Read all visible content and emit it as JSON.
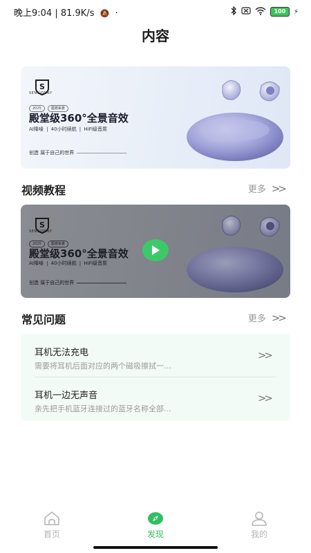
{
  "status_bar": {
    "time_net": "晚上9:04 | 81.9K/s",
    "battery": "100"
  },
  "page_title": "内容",
  "banner": {
    "brand": "SENSIONNY",
    "tags": [
      "2025",
      "震撼来袭"
    ],
    "headline": "殿堂级360°全景音效",
    "features": "AI降噪  |  40小时续航  |  HiFi级音质",
    "slogan": "创造 属于自己的世界"
  },
  "video_section": {
    "title": "视频教程",
    "more": "更多"
  },
  "faq_section": {
    "title": "常见问题",
    "more": "更多",
    "items": [
      {
        "question": "耳机无法充电",
        "answer": "需要将耳机后面对应的两个磁吸擦拭一..."
      },
      {
        "question": "耳机一边无声音",
        "answer": "亲先把手机蓝牙连接过的蓝牙名称全部..."
      }
    ]
  },
  "tabs": [
    {
      "label": "首页",
      "icon": "home-icon"
    },
    {
      "label": "发现",
      "icon": "compass-icon"
    },
    {
      "label": "我的",
      "icon": "profile-icon"
    }
  ],
  "colors": {
    "accent": "#2fbf62",
    "inactive": "#b5b5b5",
    "faq_bg": "#f3fbf7"
  }
}
